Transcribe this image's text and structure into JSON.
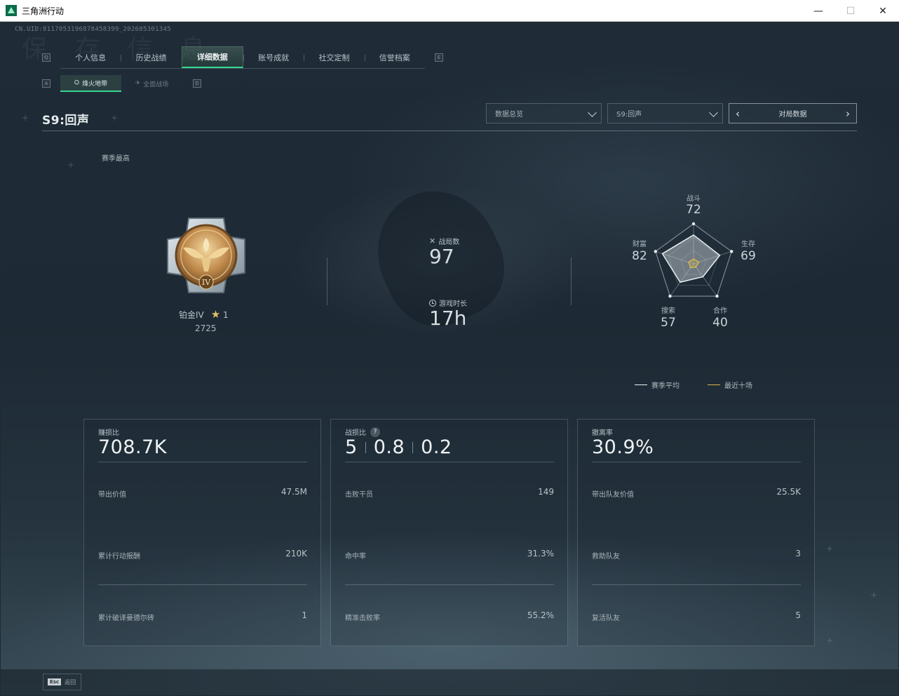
{
  "window": {
    "title": "三角洲行动",
    "minimize": "—",
    "restore": "☐",
    "close": "✕"
  },
  "uid": "CN.UID:8117053196878458399_202605301345",
  "background_text": "保 存 信 息",
  "main_tabs": {
    "left_key": "Q",
    "right_key": "E",
    "items": [
      {
        "label": "个人信息"
      },
      {
        "label": "历史战绩"
      },
      {
        "label": "详细数据",
        "active": true
      },
      {
        "label": "账号成就"
      },
      {
        "label": "社交定制"
      },
      {
        "label": "信誉档案"
      }
    ]
  },
  "sub_tabs": {
    "left_key": "A",
    "right_key": "D",
    "items": [
      {
        "label": "烽火地带",
        "icon": "⛭",
        "active": true
      },
      {
        "label": "全面战场",
        "icon": "✈"
      }
    ]
  },
  "season": {
    "title": "S9:回声",
    "best_label": "赛季最高"
  },
  "filters": {
    "overview": "数据总览",
    "season": "S9:回声",
    "match_data": "对局数据"
  },
  "rank": {
    "name": "铂金IV",
    "stars": "1",
    "score": "2725",
    "tier_numeral": "IV"
  },
  "match": {
    "games_label": "战局数",
    "games_value": "97",
    "time_label": "游戏时长",
    "time_value": "17h"
  },
  "radar": {
    "axes": [
      {
        "label": "战斗",
        "value": "72"
      },
      {
        "label": "生存",
        "value": "69"
      },
      {
        "label": "合作",
        "value": "40"
      },
      {
        "label": "搜索",
        "value": "57"
      },
      {
        "label": "财富",
        "value": "82"
      }
    ],
    "season_avg": [
      72,
      69,
      40,
      57,
      82
    ],
    "recent": [
      12,
      14,
      10,
      12,
      13
    ],
    "season_avg_color": "#e8eef0",
    "recent_color": "#d9b64a"
  },
  "legend": {
    "season_avg": "赛季平均",
    "recent": "最近十场"
  },
  "cards": [
    {
      "title": "赚损比",
      "big": "708.7K",
      "rows": [
        {
          "label": "带出价值",
          "value": "47.5M"
        },
        {
          "label": "累计行动报酬",
          "value": "210K"
        },
        {
          "label": "累计破译曼德尔砖",
          "value": "1"
        }
      ]
    },
    {
      "title": "战损比",
      "help": "?",
      "big_parts": [
        "5",
        "0.8",
        "0.2"
      ],
      "rows": [
        {
          "label": "击败干员",
          "value": "149"
        },
        {
          "label": "命中率",
          "value": "31.3%"
        },
        {
          "label": "精准击败率",
          "value": "55.2%"
        }
      ]
    },
    {
      "title": "撤离率",
      "big": "30.9%",
      "rows": [
        {
          "label": "带出队友价值",
          "value": "25.5K"
        },
        {
          "label": "救助队友",
          "value": "3"
        },
        {
          "label": "复活队友",
          "value": "5"
        }
      ]
    }
  ],
  "bottom": {
    "esc_key": "Esc",
    "back_label": "返回"
  },
  "colors": {
    "accent": "#36d58e",
    "background": "#1e2a35",
    "gold": "#d9b64a"
  }
}
